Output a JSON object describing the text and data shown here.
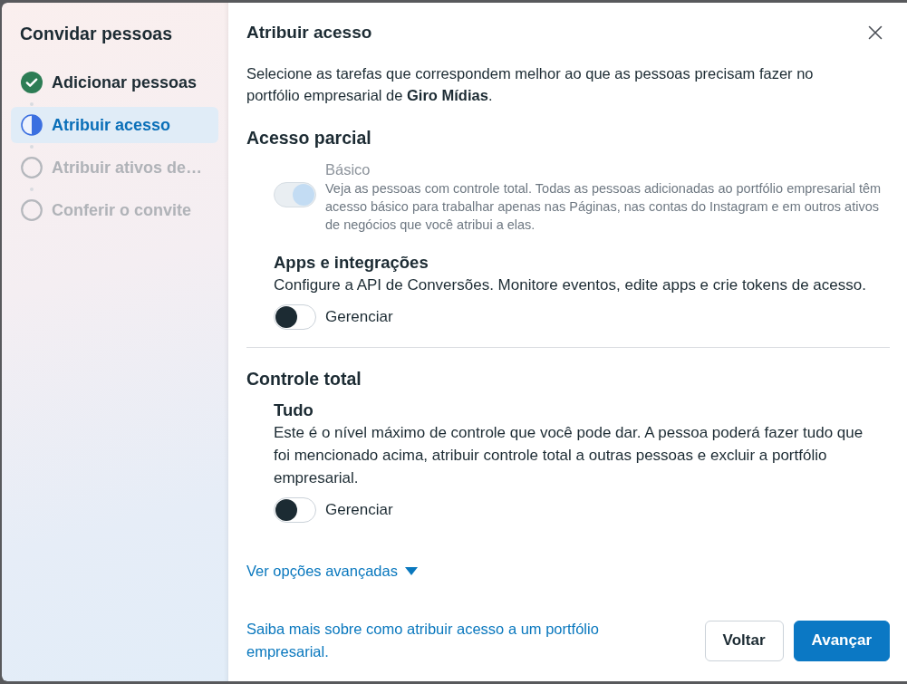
{
  "sidebar": {
    "title": "Convidar pessoas",
    "steps": [
      {
        "label": "Adicionar pessoas",
        "kind": "complete",
        "selected": false
      },
      {
        "label": "Atribuir acesso",
        "kind": "current",
        "selected": true
      },
      {
        "label": "Atribuir ativos de…",
        "kind": "pending",
        "selected": false
      },
      {
        "label": "Conferir o convite",
        "kind": "pending",
        "selected": false
      }
    ]
  },
  "panel": {
    "title": "Atribuir acesso",
    "intro": "Selecione as tarefas que correspondem melhor ao que as pessoas precisam fazer no portfólio empresarial de **Giro Mídias**.",
    "sections": [
      {
        "heading": "Acesso parcial",
        "permissions": [
          {
            "kind": "inline",
            "title": "Básico",
            "description": "Veja as pessoas com controle total. Todas as pessoas adicionadas ao portfólio empresarial têm acesso básico para trabalhar apenas nas Páginas, nas contas do Instagram e em outros ativos de negócios que você atribui a elas.",
            "on": true,
            "disabled": true
          },
          {
            "kind": "stacked",
            "title": "Apps e integrações",
            "description": "Configure a API de Conversões. Monitore eventos, edite apps e crie tokens de acesso.",
            "toggle_label": "Gerenciar",
            "on": false,
            "disabled": false
          }
        ]
      },
      {
        "heading": "Controle total",
        "permissions": [
          {
            "kind": "stacked",
            "title": "Tudo",
            "description": "Este é o nível máximo de controle que você pode dar. A pessoa poderá fazer tudo que foi mencionado acima, atribuir controle total a outras pessoas e excluir a portfólio empresarial.",
            "toggle_label": "Gerenciar",
            "on": false,
            "disabled": false
          }
        ]
      }
    ],
    "advanced_link": "Ver opções avançadas",
    "help_link": "Saiba mais sobre como atribuir acesso a um portfólio empresarial.",
    "buttons": [
      {
        "label": "Voltar",
        "kind": "secondary"
      },
      {
        "label": "Avançar",
        "kind": "primary"
      }
    ]
  }
}
